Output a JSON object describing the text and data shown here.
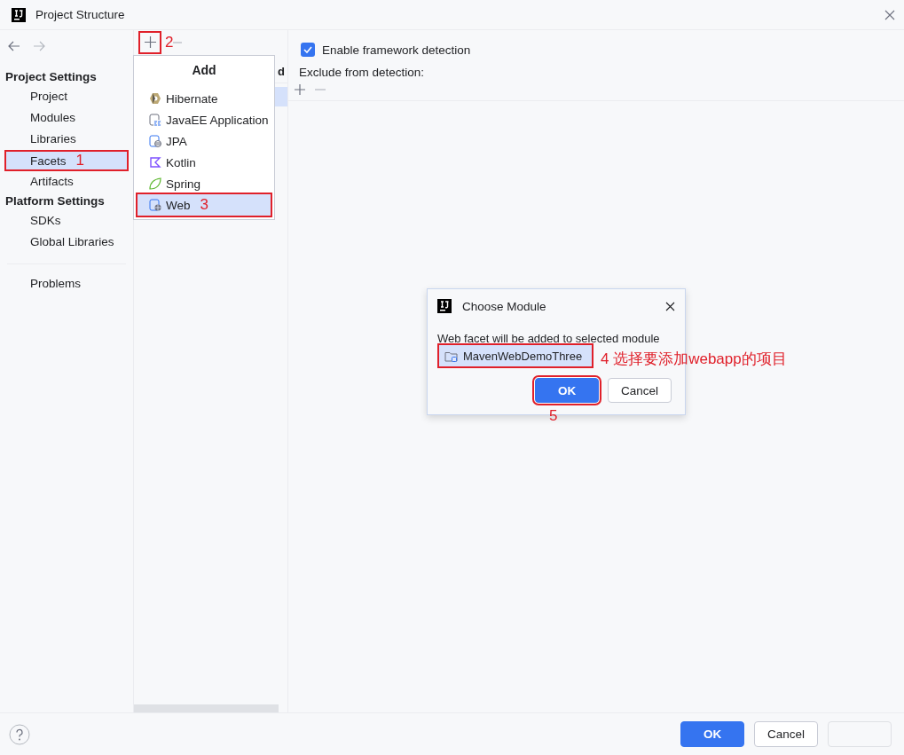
{
  "window": {
    "title": "Project Structure"
  },
  "sidebar": {
    "sections": [
      {
        "title": "Project Settings",
        "items": [
          {
            "label": "Project",
            "selected": false
          },
          {
            "label": "Modules",
            "selected": false
          },
          {
            "label": "Libraries",
            "selected": false
          },
          {
            "label": "Facets",
            "selected": true,
            "annotation": "1"
          },
          {
            "label": "Artifacts",
            "selected": false
          }
        ]
      },
      {
        "title": "Platform Settings",
        "items": [
          {
            "label": "SDKs",
            "selected": false
          },
          {
            "label": "Global Libraries",
            "selected": false
          }
        ]
      }
    ],
    "extra_items": [
      {
        "label": "Problems",
        "selected": false
      }
    ]
  },
  "toolbar": {
    "add_annotation": "2"
  },
  "facets_list": {
    "header_fragment": "d"
  },
  "add_popup": {
    "title": "Add",
    "items": [
      {
        "label": "Hibernate",
        "kind": "hibernate",
        "selected": false
      },
      {
        "label": "JavaEE Application",
        "kind": "javaee",
        "selected": false
      },
      {
        "label": "JPA",
        "kind": "jpa",
        "selected": false
      },
      {
        "label": "Kotlin",
        "kind": "kotlin",
        "selected": false
      },
      {
        "label": "Spring",
        "kind": "spring",
        "selected": false
      },
      {
        "label": "Web",
        "kind": "web",
        "selected": true,
        "annotation": "3"
      }
    ]
  },
  "detection": {
    "enable_label": "Enable framework detection",
    "checked": true,
    "exclude_label": "Exclude from detection:"
  },
  "dialog": {
    "title": "Choose Module",
    "message": "Web facet will be added to selected module",
    "modules": [
      {
        "label": "MavenWebDemoThree",
        "selected": true,
        "annotation": "4 选择要添加webapp的项目"
      }
    ],
    "buttons": [
      {
        "label": "OK",
        "kind": "primary",
        "annotation": "5"
      },
      {
        "label": "Cancel",
        "kind": "secondary"
      }
    ]
  },
  "footer": {
    "buttons": [
      {
        "label": "OK",
        "kind": "primary",
        "disabled": false
      },
      {
        "label": "Cancel",
        "kind": "secondary",
        "disabled": false
      },
      {
        "kind": "secondary",
        "disabled": true
      }
    ]
  }
}
